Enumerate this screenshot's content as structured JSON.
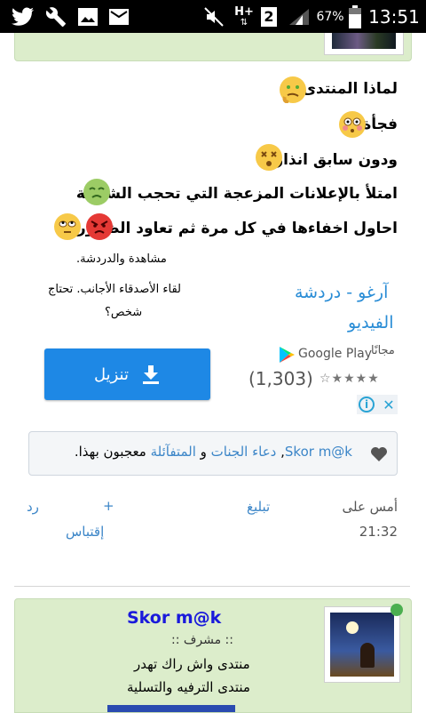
{
  "status_bar": {
    "battery_pct": "67%",
    "time": "13:51",
    "sim_slot": "2",
    "network": "H+",
    "icons_left": [
      "twitter-icon",
      "wrench-icon",
      "image-icon",
      "mail-icon"
    ],
    "icons_right": [
      "mute-icon",
      "hplus-icon",
      "sim2-icon",
      "signal-icon",
      "battery-icon"
    ]
  },
  "post": {
    "lines": [
      "لماذا المنتدى",
      "فجأة",
      "ودون سابق انذار",
      "امتلأ بالإعلانات المزعجة التي تحجب الشاشة",
      "احاول اخفاءها في كل مرة ثم تعاود الظهور"
    ]
  },
  "ad": {
    "title_line1": "آرغو - دردشة",
    "title_line2": "الفيديو",
    "desc_line1": "مشاهدة والدردشة.",
    "desc_line2": "لقاء الأصدقاء الأجانب. تحتاج",
    "desc_line3": "شخص؟",
    "free_label": "مجانًا",
    "store_label": "Google Play",
    "rating_count": "(1,303)",
    "rating_stars": 4.5,
    "install_label": "تنزيل",
    "adchoices_i": "i",
    "adchoices_x": "✕"
  },
  "likes": {
    "user1": "Skor m@k",
    "sep1": ",",
    "user2": "دعاء الجنات",
    "conj": "و",
    "user3": "المتفآئلة",
    "suffix": "معجبون بهذا."
  },
  "post_meta": {
    "time_prefix": "أمس على",
    "time_value": "21:32",
    "report_label": "تبليغ",
    "plus_label": "+",
    "quote_label": "إقتباس",
    "reply_label": "رد"
  },
  "next_post": {
    "username": "Skor m@k",
    "role": ":: مشرف ::",
    "signature_line1": "منتدى واش راك تهدر",
    "signature_line2": "منتدى الترفيه والتسلية"
  },
  "colors": {
    "link_blue": "#3c86c8",
    "ad_blue": "#2a8dd6",
    "button_blue": "#1e88e5",
    "card_green": "#dcedcb",
    "username_blue": "#1a1adb"
  }
}
